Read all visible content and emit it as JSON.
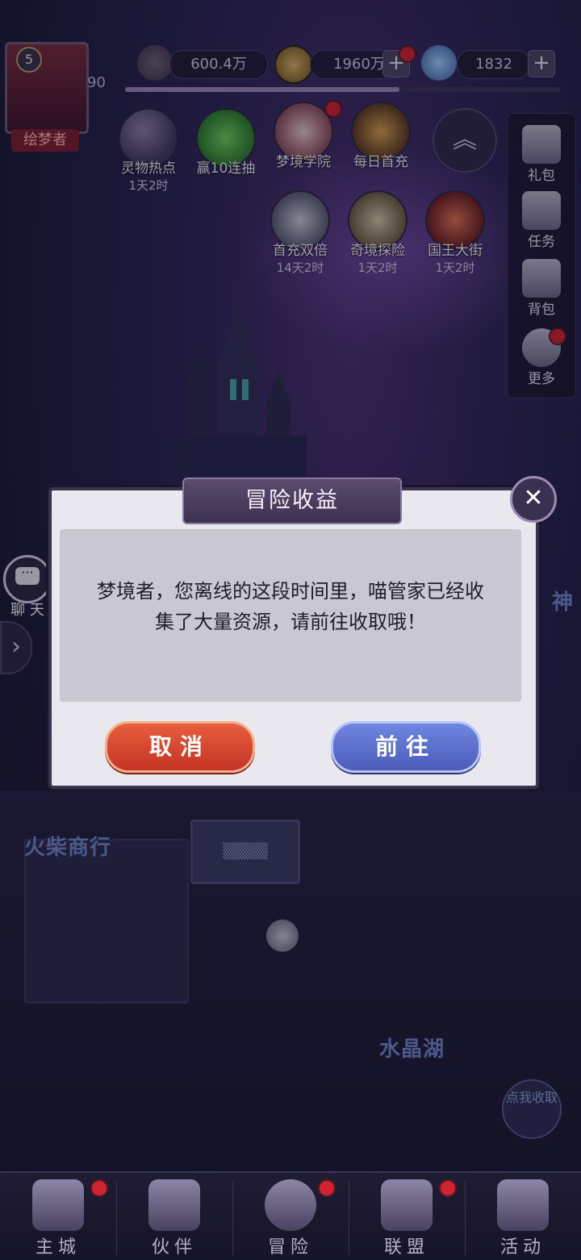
{
  "header": {
    "player": {
      "level": "5",
      "name": "绘梦者",
      "exp_level": "90",
      "exp_progress": 0.63
    },
    "resources": [
      {
        "icon": "sword-icon",
        "value": "600.4万"
      },
      {
        "icon": "gold-coin-icon",
        "value": "1960万"
      },
      {
        "icon": "diamond-icon",
        "value": "1832"
      }
    ]
  },
  "features": {
    "row1": [
      {
        "label": "灵物热点",
        "time": "1天2时"
      },
      {
        "label": "赢10连抽",
        "time": ""
      },
      {
        "label": "梦境学院",
        "time": ""
      },
      {
        "label": "每日首充",
        "time": ""
      }
    ],
    "row2": [
      {
        "label": "首充双倍",
        "time": "14天2时"
      },
      {
        "label": "奇境探险",
        "time": "1天2时"
      },
      {
        "label": "国王大街",
        "time": "1天2时"
      }
    ]
  },
  "side_menu": [
    {
      "label": "礼包"
    },
    {
      "label": "任务"
    },
    {
      "label": "背包"
    },
    {
      "label": "更多"
    }
  ],
  "chat": {
    "label": "聊 天"
  },
  "map": {
    "labels": {
      "match_shop": "火柴商行",
      "crystal_lake": "水晶湖",
      "partial_right": "神"
    },
    "tap_collect": "点我收取"
  },
  "dialog": {
    "title": "冒险收益",
    "message": "梦境者，您离线的这段时间里，喵管家已经收集了大量资源，请前往收取哦！",
    "cancel_label": "取消",
    "confirm_label": "前往"
  },
  "bottom_nav": [
    {
      "label": "主城"
    },
    {
      "label": "伙伴"
    },
    {
      "label": "冒险"
    },
    {
      "label": "联盟"
    },
    {
      "label": "活动"
    }
  ]
}
